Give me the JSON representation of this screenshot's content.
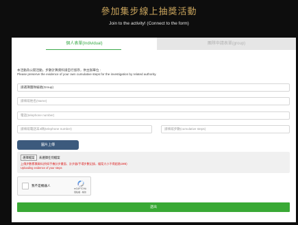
{
  "header": {
    "title_zh": "參加集步線上抽獎活動",
    "title_en": "Join to the activity! (Connect to the form)"
  },
  "tabs": [
    {
      "label": "個人表單(Individual)",
      "active": true
    },
    {
      "label": "團隊申請表單(group)",
      "active": false
    }
  ],
  "notice": {
    "line1": "本活動為公開活動，步數計算資料請自行留存，供主辦單位 :",
    "line2": "Please preserve the evidence of your own cumulative steps for the investigation by related authority."
  },
  "form": {
    "group_value": "請選擇團隊編號(Group)",
    "name_placeholder": "請填寫姓名(Name)",
    "phone_placeholder": "電話(telephone number)",
    "last4_placeholder": "請填寫電話末4碼(telephone number)",
    "steps_placeholder": "請填寫步數(cumulative steps)"
  },
  "upload": {
    "button_label": "圖片上傳",
    "file_button": "選擇檔案",
    "file_status": "未選擇任何檔案",
    "note_zh": "上傳步數累積資料(例如手機計步畫面、計步器/手環步數記錄，檔案大小不得超過1MB)",
    "note_en": "Uploading evidence of your steps"
  },
  "captcha": {
    "label": "我不是機器人",
    "brand": "reCAPTCHA",
    "links": "隱私權 - 條款"
  },
  "submit": {
    "label": "送出"
  },
  "colors": {
    "background": "#0d0d0d",
    "title_gold": "#c9a45c",
    "accent_green": "#3aa948",
    "upload_blue": "#3c5a7d",
    "submit_green": "#39a935",
    "note_red": "#dd2222"
  }
}
